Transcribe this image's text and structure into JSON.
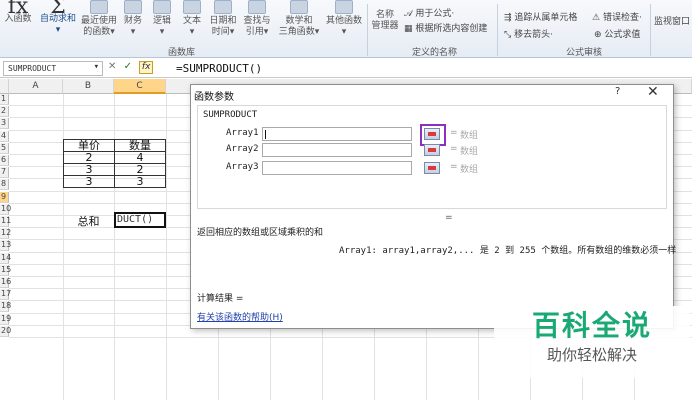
{
  "ribbon": {
    "buttons": [
      {
        "label1": "入函数",
        "label2": ""
      },
      {
        "label1": "自动求和",
        "label2": "▾"
      },
      {
        "label1": "最近使用",
        "label2": "的函数▾"
      },
      {
        "label1": "财务",
        "label2": "▾"
      },
      {
        "label1": "逻辑",
        "label2": "▾"
      },
      {
        "label1": "文本",
        "label2": "▾"
      },
      {
        "label1": "日期和",
        "label2": "时间▾"
      },
      {
        "label1": "查找与",
        "label2": "引用▾"
      },
      {
        "label1": "数学和",
        "label2": "三角函数▾"
      },
      {
        "label1": "其他函数",
        "label2": "▾"
      },
      {
        "label1": "名称",
        "label2": "管理器"
      }
    ],
    "small": {
      "use_in_formula": "用于公式·",
      "create_from_selection": "根据所选内容创建",
      "trace_dependents": "追踪从属单元格",
      "error_check": "错误检查·",
      "remove_arrows": "移去箭头·",
      "evaluate_formula": "公式求值",
      "watch_window": "监视窗口"
    },
    "groups": {
      "function_library": "函数库",
      "defined_names": "定义的名称",
      "formula_auditing": "公式审核"
    }
  },
  "formula_bar": {
    "name_box": "SUMPRODUCT",
    "cancel": "✕",
    "enter": "✓",
    "fx": "fx",
    "formula": "=SUMPRODUCT()"
  },
  "sheet": {
    "columns": [
      "A",
      "B",
      "C"
    ],
    "rows": [
      "1",
      "2",
      "3",
      "4",
      "5",
      "6",
      "7",
      "8",
      "9",
      "10",
      "11",
      "12",
      "13",
      "14",
      "15",
      "16",
      "17",
      "18",
      "19",
      "20"
    ],
    "table_headers": [
      "单价",
      "数量"
    ],
    "table_rows": [
      [
        "2",
        "4"
      ],
      [
        "3",
        "2"
      ],
      [
        "3",
        "3"
      ]
    ],
    "sum_label": "总和",
    "active_cell_text": "DUCT()"
  },
  "dialog": {
    "title": "函数参数",
    "help": "?",
    "close": "✕",
    "function_name": "SUMPRODUCT",
    "args": [
      {
        "label": "Array1",
        "eq": "=",
        "result": "数组"
      },
      {
        "label": "Array2",
        "eq": "=",
        "result": "数组"
      },
      {
        "label": "Array3",
        "eq": "=",
        "result": "数组"
      }
    ],
    "result_eq": "=",
    "description": "返回相应的数组或区域乘积的和",
    "arg_description": "Array1: array1,array2,... 是 2 到 255 个数组。所有数组的维数必须一样",
    "calc_result": "计算结果 =",
    "help_link": "有关该函数的帮助(H)"
  },
  "watermark": {
    "title": "百科全说",
    "subtitle": "助你轻松解决"
  }
}
